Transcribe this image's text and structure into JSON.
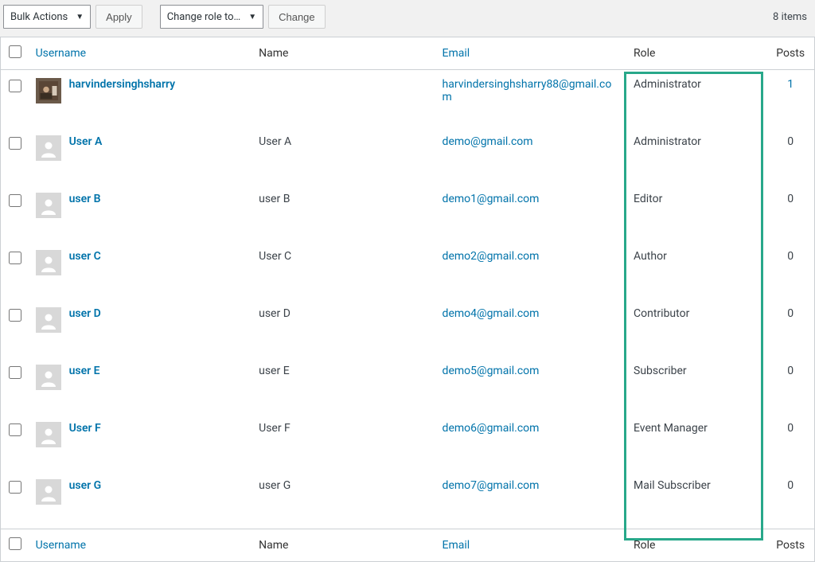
{
  "toolbar": {
    "bulk_actions_label": "Bulk Actions",
    "apply_label": "Apply",
    "change_role_label": "Change role to…",
    "change_label": "Change",
    "item_count": "8 items"
  },
  "columns": {
    "username": "Username",
    "name": "Name",
    "email": "Email",
    "role": "Role",
    "posts": "Posts"
  },
  "users": [
    {
      "username": "harvindersinghsharry",
      "name": "",
      "email": "harvindersinghsharry88@gmail.com",
      "role": "Administrator",
      "posts": "1",
      "has_avatar": true
    },
    {
      "username": "User A",
      "name": "User A",
      "email": "demo@gmail.com",
      "role": "Administrator",
      "posts": "0",
      "has_avatar": false
    },
    {
      "username": "user B",
      "name": "user B",
      "email": "demo1@gmail.com",
      "role": "Editor",
      "posts": "0",
      "has_avatar": false
    },
    {
      "username": "user C",
      "name": "User C",
      "email": "demo2@gmail.com",
      "role": "Author",
      "posts": "0",
      "has_avatar": false
    },
    {
      "username": "user D",
      "name": "user D",
      "email": "demo4@gmail.com",
      "role": "Contributor",
      "posts": "0",
      "has_avatar": false
    },
    {
      "username": "user E",
      "name": "user E",
      "email": "demo5@gmail.com",
      "role": "Subscriber",
      "posts": "0",
      "has_avatar": false
    },
    {
      "username": "User F",
      "name": "User F",
      "email": "demo6@gmail.com",
      "role": "Event Manager",
      "posts": "0",
      "has_avatar": false
    },
    {
      "username": "user G",
      "name": "user G",
      "email": "demo7@gmail.com",
      "role": "Mail Subscriber",
      "posts": "0",
      "has_avatar": false
    }
  ],
  "highlight": {
    "column": "role"
  }
}
